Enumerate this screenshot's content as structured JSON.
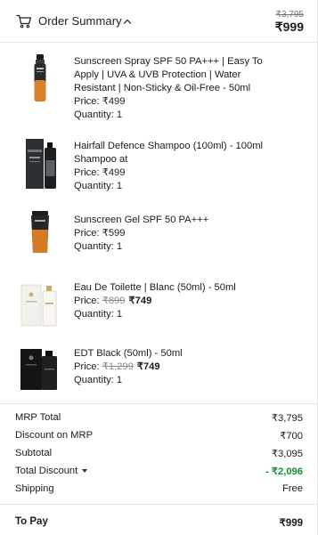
{
  "header": {
    "title": "Order Summary",
    "mrp_total": "₹3,795",
    "total": "₹999"
  },
  "items": [
    {
      "name": "Sunscreen Spray SPF 50 PA+++ | Easy To Apply | UVA & UVB Protection | Water Resistant | Non-Sticky & Oil-Free - 50ml",
      "price_label": "Price: ",
      "original_price": "",
      "price": "₹499",
      "quantity": "Quantity: 1"
    },
    {
      "name": "Hairfall Defence Shampoo (100ml) - 100ml Shampoo at",
      "price_label": "Price: ",
      "original_price": "",
      "price": "₹499",
      "quantity": "Quantity: 1"
    },
    {
      "name": "Sunscreen Gel SPF 50 PA+++",
      "price_label": "Price: ",
      "original_price": "",
      "price": "₹599",
      "quantity": "Quantity: 1"
    },
    {
      "name": "Eau De Toilette | Blanc (50ml) - 50ml",
      "price_label": "Price: ",
      "original_price": "₹899",
      "price": "₹749",
      "quantity": "Quantity: 1"
    },
    {
      "name": "EDT Black (50ml) - 50ml",
      "price_label": "Price: ",
      "original_price": "₹1,299",
      "price": "₹749",
      "quantity": "Quantity: 1"
    }
  ],
  "summary": {
    "mrp_total": {
      "label": "MRP Total",
      "value": "₹3,795"
    },
    "discount_on_mrp": {
      "label": "Discount on MRP",
      "value": "₹700"
    },
    "subtotal": {
      "label": "Subtotal",
      "value": "₹3,095"
    },
    "total_discount": {
      "label": "Total Discount",
      "value": "- ₹2,096"
    },
    "shipping": {
      "label": "Shipping",
      "value": "Free"
    }
  },
  "to_pay": {
    "label": "To Pay",
    "value": "₹999"
  },
  "colors": {
    "discount_green": "#1a8a3a",
    "text": "#1c1c1c",
    "muted": "#8a8a8a"
  },
  "icons": [
    "cart-icon",
    "chevron-up-icon",
    "caret-down-icon"
  ]
}
